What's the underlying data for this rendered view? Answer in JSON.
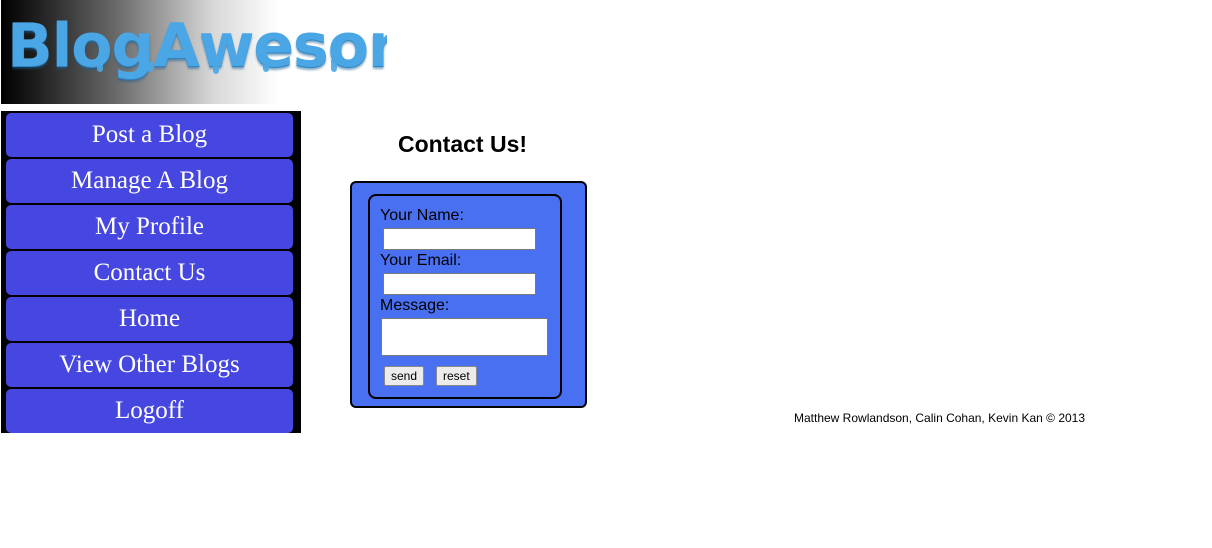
{
  "header": {
    "logo_text": "BlogAwesome!"
  },
  "sidebar": {
    "items": [
      {
        "label": "Post a Blog"
      },
      {
        "label": "Manage A Blog"
      },
      {
        "label": "My Profile"
      },
      {
        "label": "Contact Us"
      },
      {
        "label": "Home"
      },
      {
        "label": "View Other Blogs"
      },
      {
        "label": "Logoff"
      }
    ]
  },
  "main": {
    "title": "Contact Us!",
    "form": {
      "name_label": "Your Name:",
      "name_value": "",
      "email_label": "Your Email:",
      "email_value": "",
      "message_label": "Message:",
      "message_value": "",
      "send_label": "send",
      "reset_label": "reset"
    }
  },
  "footer": {
    "credits": "Matthew Rowlandson, Calin Cohan, Kevin Kan © 2013"
  },
  "colors": {
    "nav_button": "#4646e0",
    "form_background": "#4a70f2",
    "logo": "#4aa6e4"
  }
}
